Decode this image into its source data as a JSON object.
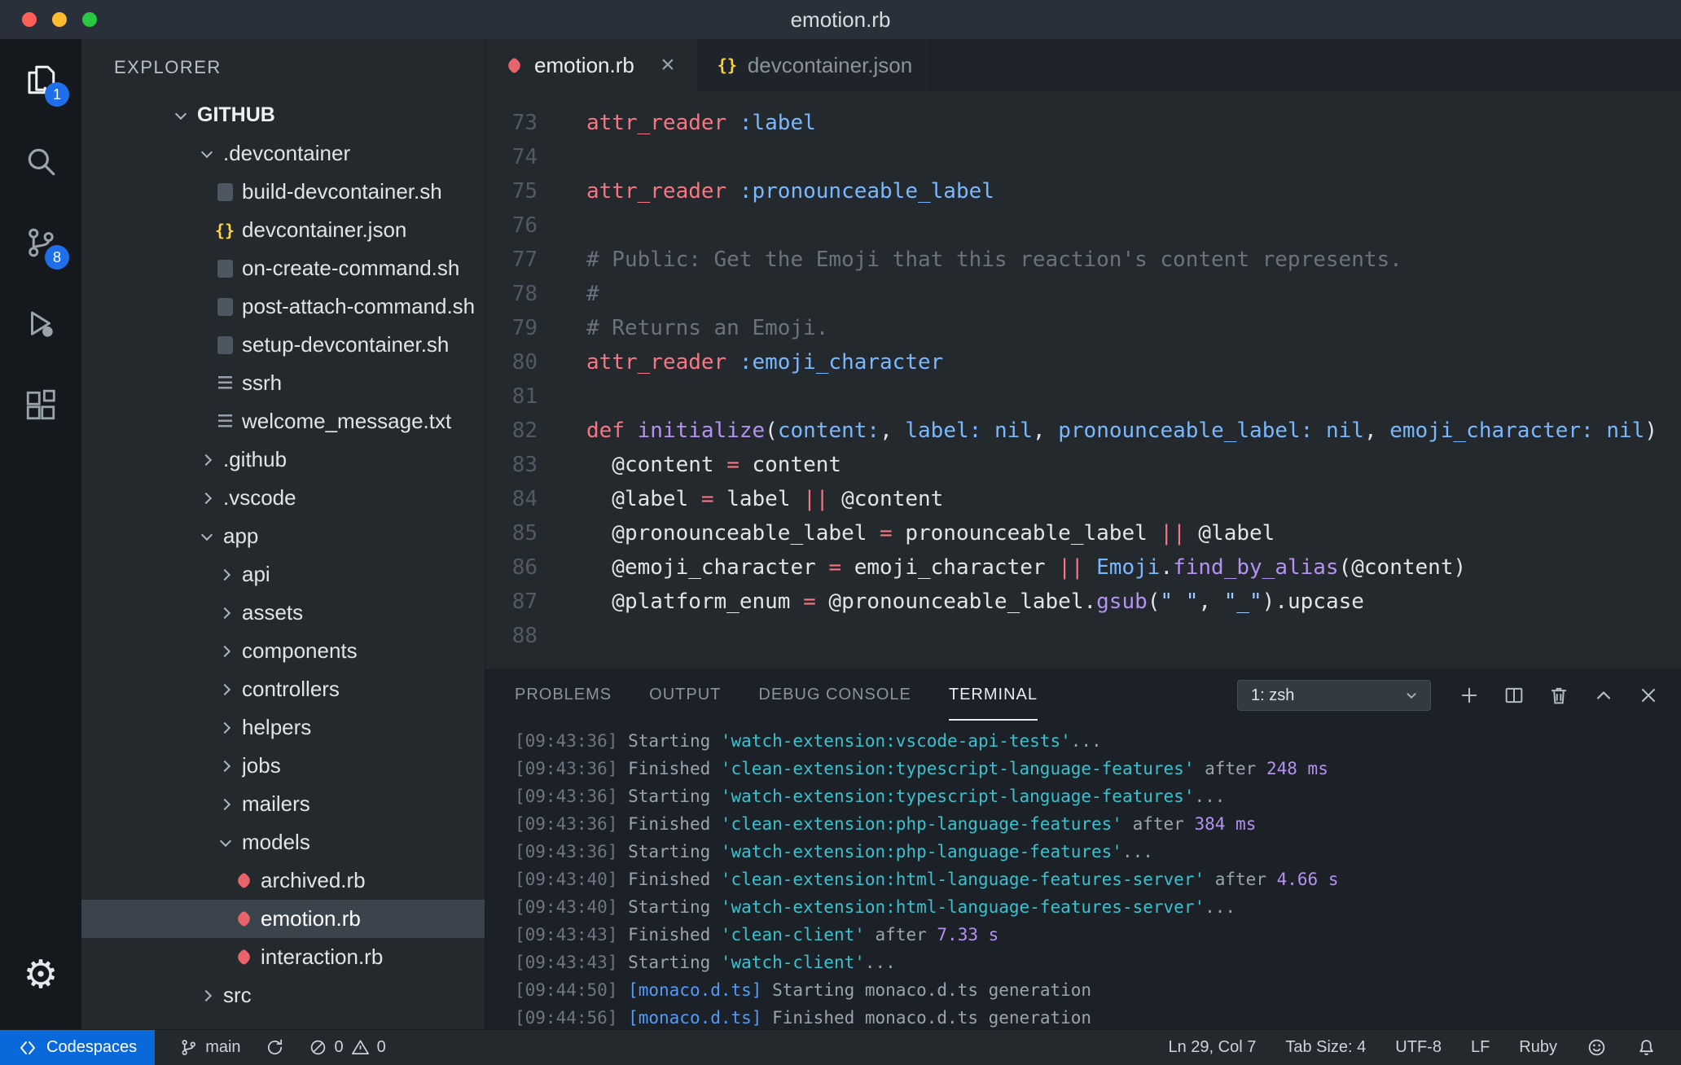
{
  "window": {
    "title": "emotion.rb",
    "traffic_lights": [
      "close-button",
      "minimize-button",
      "zoom-button"
    ]
  },
  "activity_bar": {
    "items": [
      "explorer",
      "search",
      "source-control",
      "run-debug",
      "extensions",
      "settings-gear"
    ],
    "explorer_badge": "1",
    "scm_badge": "8"
  },
  "sidebar": {
    "header": "EXPLORER",
    "section": "GITHUB",
    "tree": [
      {
        "label": ".devcontainer",
        "kind": "folder",
        "expanded": true,
        "level": 1
      },
      {
        "label": "build-devcontainer.sh",
        "kind": "shell",
        "level": 2
      },
      {
        "label": "devcontainer.json",
        "kind": "json",
        "level": 2
      },
      {
        "label": "on-create-command.sh",
        "kind": "shell",
        "level": 2
      },
      {
        "label": "post-attach-command.sh",
        "kind": "shell",
        "level": 2
      },
      {
        "label": "setup-devcontainer.sh",
        "kind": "shell",
        "level": 2
      },
      {
        "label": "ssrh",
        "kind": "text",
        "level": 2
      },
      {
        "label": "welcome_message.txt",
        "kind": "text",
        "level": 2
      },
      {
        "label": ".github",
        "kind": "folder",
        "expanded": false,
        "level": 1
      },
      {
        "label": ".vscode",
        "kind": "folder",
        "expanded": false,
        "level": 1
      },
      {
        "label": "app",
        "kind": "folder",
        "expanded": true,
        "level": 1
      },
      {
        "label": "api",
        "kind": "folder",
        "expanded": false,
        "level": 2
      },
      {
        "label": "assets",
        "kind": "folder",
        "expanded": false,
        "level": 2
      },
      {
        "label": "components",
        "kind": "folder",
        "expanded": false,
        "level": 2
      },
      {
        "label": "controllers",
        "kind": "folder",
        "expanded": false,
        "level": 2
      },
      {
        "label": "helpers",
        "kind": "folder",
        "expanded": false,
        "level": 2
      },
      {
        "label": "jobs",
        "kind": "folder",
        "expanded": false,
        "level": 2
      },
      {
        "label": "mailers",
        "kind": "folder",
        "expanded": false,
        "level": 2
      },
      {
        "label": "models",
        "kind": "folder",
        "expanded": true,
        "level": 2
      },
      {
        "label": "archived.rb",
        "kind": "ruby",
        "level": 3
      },
      {
        "label": "emotion.rb",
        "kind": "ruby",
        "level": 3,
        "selected": true
      },
      {
        "label": "interaction.rb",
        "kind": "ruby",
        "level": 3
      },
      {
        "label": "src",
        "kind": "folder",
        "expanded": false,
        "level": 1
      }
    ]
  },
  "editor": {
    "tabs": [
      {
        "label": "emotion.rb",
        "icon": "ruby-file-icon",
        "active": true
      },
      {
        "label": "devcontainer.json",
        "icon": "json-braces-icon",
        "active": false
      }
    ],
    "lines": [
      {
        "num": "73",
        "tokens": [
          [
            "kw",
            "attr_reader"
          ],
          [
            "pl",
            " "
          ],
          [
            "sym",
            ":label"
          ]
        ]
      },
      {
        "num": "74",
        "tokens": []
      },
      {
        "num": "75",
        "tokens": [
          [
            "kw",
            "attr_reader"
          ],
          [
            "pl",
            " "
          ],
          [
            "sym",
            ":pronounceable_label"
          ]
        ]
      },
      {
        "num": "76",
        "tokens": []
      },
      {
        "num": "77",
        "tokens": [
          [
            "cm",
            "# Public: Get the Emoji that this reaction's content represents."
          ]
        ]
      },
      {
        "num": "78",
        "tokens": [
          [
            "cm",
            "#"
          ]
        ]
      },
      {
        "num": "79",
        "tokens": [
          [
            "cm",
            "# Returns an Emoji."
          ]
        ]
      },
      {
        "num": "80",
        "tokens": [
          [
            "kw",
            "attr_reader"
          ],
          [
            "pl",
            " "
          ],
          [
            "sym",
            ":emoji_character"
          ]
        ]
      },
      {
        "num": "81",
        "tokens": []
      },
      {
        "num": "82",
        "tokens": [
          [
            "kw",
            "def"
          ],
          [
            "pl",
            " "
          ],
          [
            "fn",
            "initialize"
          ],
          [
            "pl",
            "("
          ],
          [
            "sym",
            "content:"
          ],
          [
            "pl",
            ", "
          ],
          [
            "sym",
            "label:"
          ],
          [
            "pl",
            " "
          ],
          [
            "sym",
            "nil"
          ],
          [
            "pl",
            ", "
          ],
          [
            "sym",
            "pronounceable_label:"
          ],
          [
            "pl",
            " "
          ],
          [
            "sym",
            "nil"
          ],
          [
            "pl",
            ", "
          ],
          [
            "sym",
            "emoji_character:"
          ],
          [
            "pl",
            " "
          ],
          [
            "sym",
            "nil"
          ],
          [
            "pl",
            ")"
          ]
        ]
      },
      {
        "num": "83",
        "tokens": [
          [
            "pl",
            "  @content "
          ],
          [
            "kw",
            "="
          ],
          [
            "pl",
            " content"
          ]
        ]
      },
      {
        "num": "84",
        "tokens": [
          [
            "pl",
            "  @label "
          ],
          [
            "kw",
            "="
          ],
          [
            "pl",
            " label "
          ],
          [
            "kw",
            "||"
          ],
          [
            "pl",
            " @content"
          ]
        ]
      },
      {
        "num": "85",
        "tokens": [
          [
            "pl",
            "  @pronounceable_label "
          ],
          [
            "kw",
            "="
          ],
          [
            "pl",
            " pronounceable_label "
          ],
          [
            "kw",
            "||"
          ],
          [
            "pl",
            " @label"
          ]
        ]
      },
      {
        "num": "86",
        "tokens": [
          [
            "pl",
            "  @emoji_character "
          ],
          [
            "kw",
            "="
          ],
          [
            "pl",
            " emoji_character "
          ],
          [
            "kw",
            "||"
          ],
          [
            "pl",
            " "
          ],
          [
            "const",
            "Emoji"
          ],
          [
            "pl",
            "."
          ],
          [
            "fn",
            "find_by_alias"
          ],
          [
            "pl",
            "(@content)"
          ]
        ]
      },
      {
        "num": "87",
        "tokens": [
          [
            "pl",
            "  @platform_enum "
          ],
          [
            "kw",
            "="
          ],
          [
            "pl",
            " @pronounceable_label."
          ],
          [
            "fn",
            "gsub"
          ],
          [
            "pl",
            "("
          ],
          [
            "str",
            "\" \""
          ],
          [
            "pl",
            ", "
          ],
          [
            "str",
            "\"_\""
          ],
          [
            "pl",
            ").upcase"
          ]
        ]
      },
      {
        "num": "88",
        "tokens": []
      }
    ]
  },
  "panel": {
    "tabs": [
      {
        "label": "PROBLEMS",
        "active": false
      },
      {
        "label": "OUTPUT",
        "active": false
      },
      {
        "label": "DEBUG CONSOLE",
        "active": false
      },
      {
        "label": "TERMINAL",
        "active": true
      }
    ],
    "shell_selector": "1: zsh",
    "actions": [
      "new-terminal",
      "split-terminal",
      "kill-terminal",
      "maximize-panel",
      "close-panel"
    ],
    "terminal": [
      [
        [
          "ts",
          "[09:43:36]"
        ],
        [
          "tp",
          " Starting "
        ],
        [
          "cy",
          "'watch-extension:vscode-api-tests'"
        ],
        [
          "tp",
          "..."
        ]
      ],
      [
        [
          "ts",
          "[09:43:36]"
        ],
        [
          "tp",
          " Finished "
        ],
        [
          "cy",
          "'clean-extension:typescript-language-features'"
        ],
        [
          "tp",
          " after "
        ],
        [
          "mg",
          "248 ms"
        ]
      ],
      [
        [
          "ts",
          "[09:43:36]"
        ],
        [
          "tp",
          " Starting "
        ],
        [
          "cy",
          "'watch-extension:typescript-language-features'"
        ],
        [
          "tp",
          "..."
        ]
      ],
      [
        [
          "ts",
          "[09:43:36]"
        ],
        [
          "tp",
          " Finished "
        ],
        [
          "cy",
          "'clean-extension:php-language-features'"
        ],
        [
          "tp",
          " after "
        ],
        [
          "mg",
          "384 ms"
        ]
      ],
      [
        [
          "ts",
          "[09:43:36]"
        ],
        [
          "tp",
          " Starting "
        ],
        [
          "cy",
          "'watch-extension:php-language-features'"
        ],
        [
          "tp",
          "..."
        ]
      ],
      [
        [
          "ts",
          "[09:43:40]"
        ],
        [
          "tp",
          " Finished "
        ],
        [
          "cy",
          "'clean-extension:html-language-features-server'"
        ],
        [
          "tp",
          " after "
        ],
        [
          "mg",
          "4.66 s"
        ]
      ],
      [
        [
          "ts",
          "[09:43:40]"
        ],
        [
          "tp",
          " Starting "
        ],
        [
          "cy",
          "'watch-extension:html-language-features-server'"
        ],
        [
          "tp",
          "..."
        ]
      ],
      [
        [
          "ts",
          "[09:43:43]"
        ],
        [
          "tp",
          " Finished "
        ],
        [
          "cy",
          "'clean-client'"
        ],
        [
          "tp",
          " after "
        ],
        [
          "mg",
          "7.33 s"
        ]
      ],
      [
        [
          "ts",
          "[09:43:43]"
        ],
        [
          "tp",
          " Starting "
        ],
        [
          "cy",
          "'watch-client'"
        ],
        [
          "tp",
          "..."
        ]
      ],
      [
        [
          "ts",
          "[09:44:50]"
        ],
        [
          "tp",
          " "
        ],
        [
          "bl",
          "[monaco.d.ts]"
        ],
        [
          "tp",
          " Starting monaco.d.ts generation"
        ]
      ],
      [
        [
          "ts",
          "[09:44:56]"
        ],
        [
          "tp",
          " "
        ],
        [
          "bl",
          "[monaco.d.ts]"
        ],
        [
          "tp",
          " Finished monaco.d.ts generation"
        ]
      ]
    ]
  },
  "status_bar": {
    "codespaces": "Codespaces",
    "branch": "main",
    "errors": "0",
    "warnings": "0",
    "line_col": "Ln 29, Col 7",
    "tab_size": "Tab Size: 4",
    "encoding": "UTF-8",
    "eol": "LF",
    "language": "Ruby",
    "right_icons": [
      "feedback-smiley",
      "notifications-bell"
    ]
  },
  "colors": {
    "accent_blue": "#0969da",
    "badge_blue": "#1f6feb",
    "keyword_red": "#f97583",
    "symbol_blue": "#79b8ff",
    "function_purple": "#b392f0",
    "comment_gray": "#6a737d",
    "string_blue": "#9ecbff",
    "terminal_cyan": "#3bc0cd",
    "terminal_magenta": "#b392f0",
    "ruby_icon_red": "#e9636b",
    "json_icon_yellow": "#ffd33d"
  }
}
